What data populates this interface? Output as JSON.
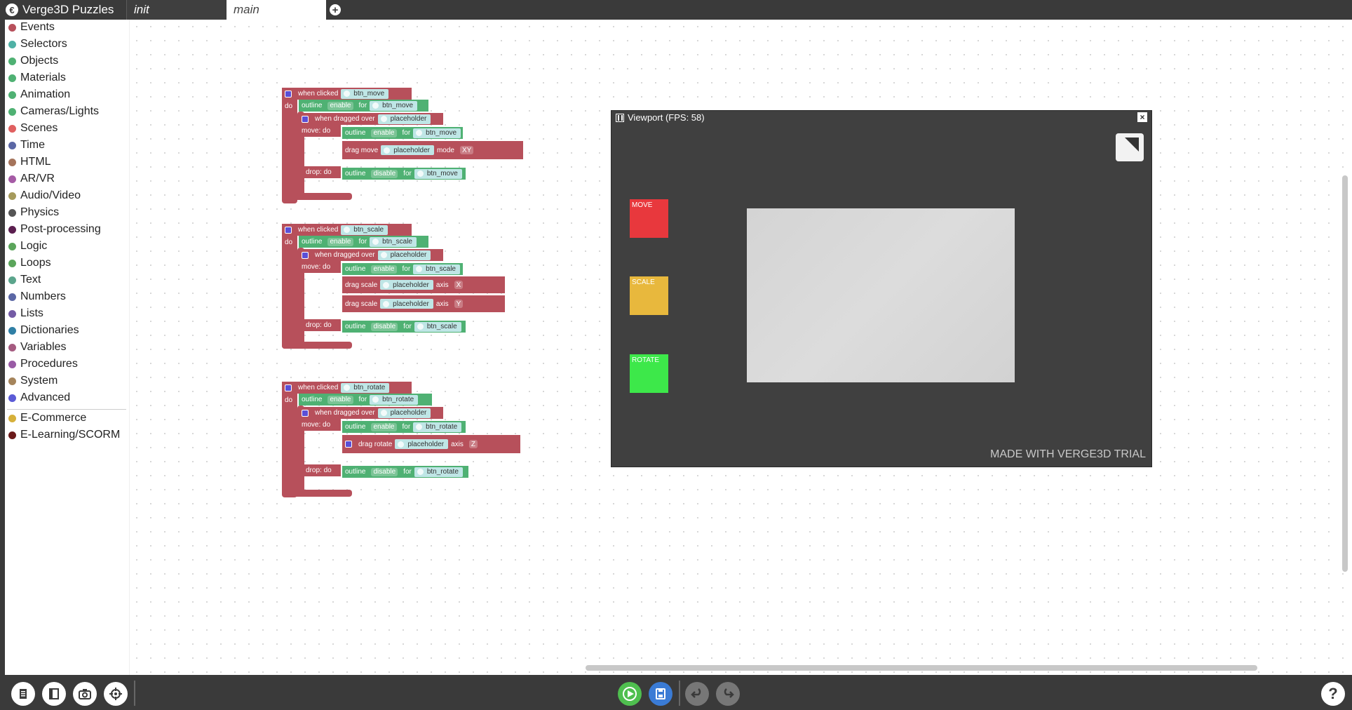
{
  "app": {
    "title": "Verge3D Puzzles",
    "logo": "verge3d-logo"
  },
  "tabs": [
    {
      "label": "init",
      "active": false
    },
    {
      "label": "main",
      "active": true
    }
  ],
  "categories": [
    {
      "label": "Events",
      "color": "#b7505b"
    },
    {
      "label": "Selectors",
      "color": "#4fb1a5"
    },
    {
      "label": "Objects",
      "color": "#4fb173"
    },
    {
      "label": "Materials",
      "color": "#4fb173"
    },
    {
      "label": "Animation",
      "color": "#4fb173"
    },
    {
      "label": "Cameras/Lights",
      "color": "#4fb173"
    },
    {
      "label": "Scenes",
      "color": "#e06060"
    },
    {
      "label": "Time",
      "color": "#5b67a5"
    },
    {
      "label": "HTML",
      "color": "#a5745b"
    },
    {
      "label": "AR/VR",
      "color": "#a55ba5"
    },
    {
      "label": "Audio/Video",
      "color": "#a59a5b"
    },
    {
      "label": "Physics",
      "color": "#555555"
    },
    {
      "label": "Post-processing",
      "color": "#5b1f4f"
    },
    {
      "label": "Logic",
      "color": "#5ba55b"
    },
    {
      "label": "Loops",
      "color": "#5ba55b"
    },
    {
      "label": "Text",
      "color": "#5ba58c"
    },
    {
      "label": "Numbers",
      "color": "#5b67a5"
    },
    {
      "label": "Lists",
      "color": "#745ba5"
    },
    {
      "label": "Dictionaries",
      "color": "#2f7fa5"
    },
    {
      "label": "Variables",
      "color": "#a55b80"
    },
    {
      "label": "Procedures",
      "color": "#995ba5"
    },
    {
      "label": "System",
      "color": "#a5845b"
    },
    {
      "label": "Advanced",
      "color": "#5b5bd6"
    }
  ],
  "plugins": [
    {
      "label": "E-Commerce",
      "color": "#d6b03a"
    },
    {
      "label": "E-Learning/SCORM",
      "color": "#6b1a1a"
    }
  ],
  "blocks": {
    "when_clicked": "when clicked",
    "do": "do",
    "outline": "outline",
    "enable": "enable",
    "disable": "disable",
    "for": "for",
    "when_dragged_over": "when dragged over",
    "placeholder": "placeholder",
    "move_do": "move: do",
    "drop_do": "drop: do",
    "drag_move": "drag move",
    "drag_scale": "drag scale",
    "drag_rotate": "drag rotate",
    "mode": "mode",
    "axis": "axis",
    "xy": "XY",
    "x": "X",
    "y": "Y",
    "z": "Z",
    "btn_move": "btn_move",
    "btn_scale": "btn_scale",
    "btn_rotate": "btn_rotate"
  },
  "viewport": {
    "title": "Viewport (FPS: 58)",
    "close": "×",
    "buttons": [
      {
        "label": "MOVE",
        "color": "#e8383d"
      },
      {
        "label": "SCALE",
        "color": "#e8b83d"
      },
      {
        "label": "ROTATE",
        "color": "#3de84a"
      }
    ],
    "watermark": "MADE WITH VERGE3D TRIAL"
  },
  "toolbar": {
    "icons": [
      "files-icon",
      "sidebar-icon",
      "screenshot-icon",
      "center-icon",
      "run-icon",
      "save-icon",
      "undo-icon",
      "redo-icon",
      "help-icon"
    ],
    "help": "?"
  }
}
